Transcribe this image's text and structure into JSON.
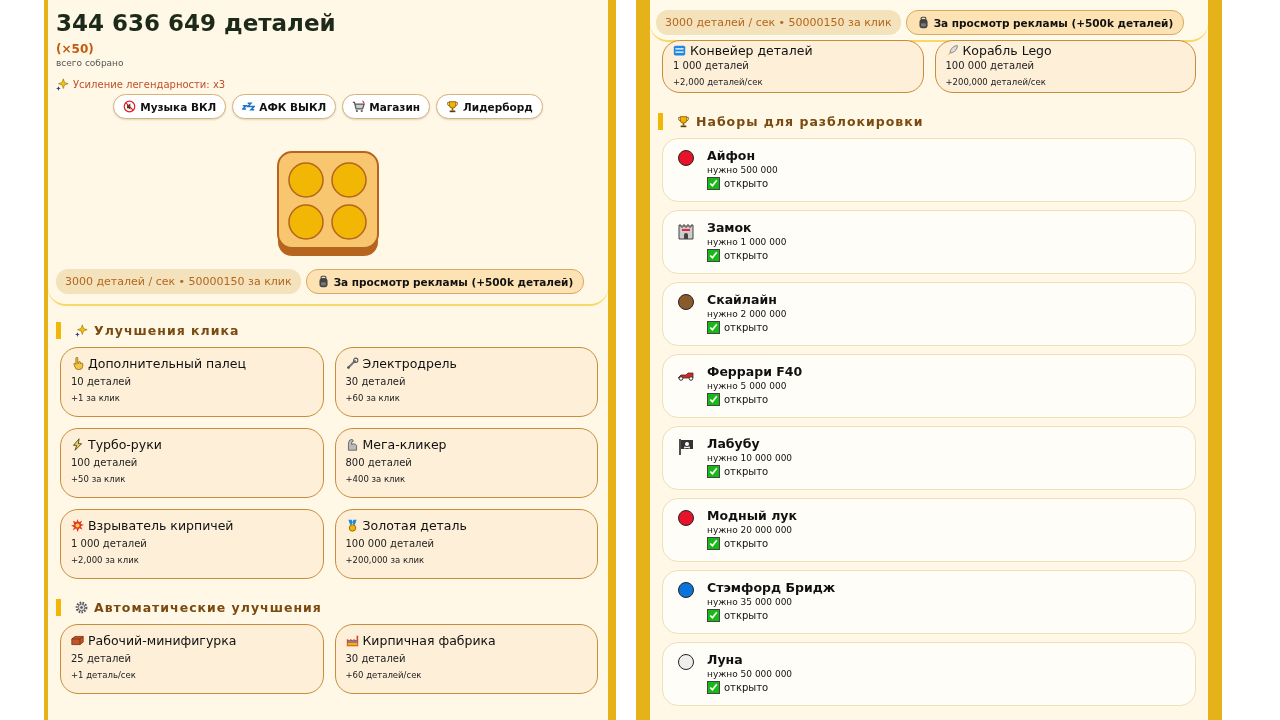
{
  "left": {
    "counter": "344 636 649 деталей",
    "multiplier": "(×50)",
    "counter_caption": "всего собрано",
    "bonus": "Усиление легендарности: x3",
    "buttons": [
      "Музыка ВКЛ",
      "АФК ВЫКЛ",
      "Магазин",
      "Лидерборд"
    ],
    "stats": "3000 деталей / сек • 50000150 за клик",
    "ad_button": "За просмотр рекламы (+500k деталей)",
    "sections": [
      {
        "title": "Улучшения клика",
        "items": [
          {
            "name": "Дополнительный палец",
            "price": "10 деталей",
            "effect": "+1 за клик"
          },
          {
            "name": "Электродрель",
            "price": "30 деталей",
            "effect": "+60 за клик"
          },
          {
            "name": "Турбо-руки",
            "price": "100 деталей",
            "effect": "+50 за клик"
          },
          {
            "name": "Мега-кликер",
            "price": "800 деталей",
            "effect": "+400 за клик"
          },
          {
            "name": "Взрыватель кирпичей",
            "price": "1 000 деталей",
            "effect": "+2,000 за клик"
          },
          {
            "name": "Золотая деталь",
            "price": "100 000 деталей",
            "effect": "+200,000 за клик"
          }
        ]
      },
      {
        "title": "Автоматические улучшения",
        "items": [
          {
            "name": "Рабочий-минифигурка",
            "price": "25 деталей",
            "effect": "+1 деталь/сек"
          },
          {
            "name": "Кирпичная фабрика",
            "price": "30 деталей",
            "effect": "+60 деталей/сек"
          }
        ]
      }
    ]
  },
  "right": {
    "stats": "3000 деталей / сек • 50000150 за клик",
    "ad_button": "За просмотр рекламы (+500k деталей)",
    "items": [
      {
        "name": "Конвейер деталей",
        "price": "1 000 деталей",
        "effect": "+2,000 деталей/сек"
      },
      {
        "name": "Корабль Lego",
        "price": "100 000 деталей",
        "effect": "+200,000 деталей/сек"
      }
    ],
    "sets_title": "Наборы для разблокировки",
    "sets": [
      {
        "kind": "dot",
        "color": "#e8122a",
        "name": "Айфон",
        "requirement": "нужно 500 000",
        "status": "открыто",
        "unlocked": true
      },
      {
        "kind": "castle",
        "name": "Замок",
        "requirement": "нужно 1 000 000",
        "status": "открыто",
        "unlocked": true
      },
      {
        "kind": "dot",
        "color": "#8b5a2b",
        "name": "Скайлайн",
        "requirement": "нужно 2 000 000",
        "status": "открыто",
        "unlocked": true
      },
      {
        "kind": "car",
        "name": "Феррари F40",
        "requirement": "нужно 5 000 000",
        "status": "открыто",
        "unlocked": true
      },
      {
        "kind": "flag",
        "name": "Лабубу",
        "requirement": "нужно 10 000 000",
        "status": "открыто",
        "unlocked": true
      },
      {
        "kind": "dot",
        "color": "#e8122a",
        "name": "Модный лук",
        "requirement": "нужно 20 000 000",
        "status": "открыто",
        "unlocked": true
      },
      {
        "kind": "dot",
        "color": "#0a74da",
        "name": "Стэмфорд Бридж",
        "requirement": "нужно 35 000 000",
        "status": "открыто",
        "unlocked": true
      },
      {
        "kind": "dot",
        "color": "#eeeeee",
        "name": "Луна",
        "requirement": "нужно 50 000 000",
        "status": "открыто",
        "unlocked": true
      }
    ]
  }
}
